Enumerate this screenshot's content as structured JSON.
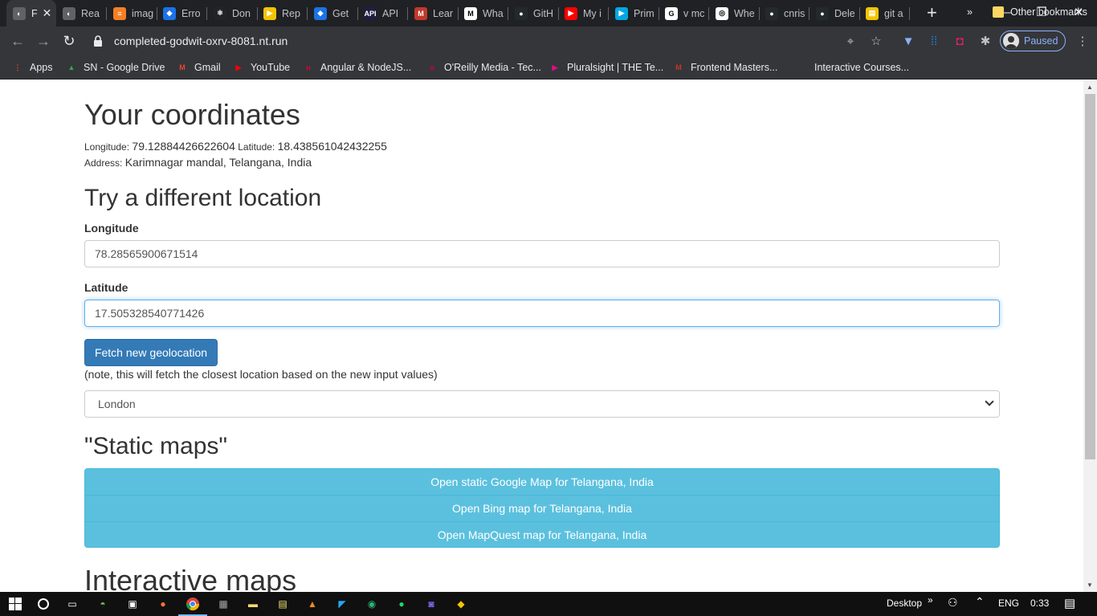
{
  "browser": {
    "tabs": [
      {
        "label": "F",
        "active": true,
        "color": "#5f6368",
        "glyph": "◐"
      },
      {
        "label": "Rea",
        "color": "#5f6368",
        "glyph": "◐"
      },
      {
        "label": "imag",
        "color": "#f48024",
        "glyph": "≡"
      },
      {
        "label": "Erro",
        "color": "#1a73e8",
        "glyph": "◆"
      },
      {
        "label": "Don",
        "color": "#20232a",
        "glyph": "⚛"
      },
      {
        "label": "Rep",
        "color": "#f5c400",
        "glyph": "▶"
      },
      {
        "label": "Get",
        "color": "#1a73e8",
        "glyph": "◆"
      },
      {
        "label": "API",
        "color": "#1e1e3f",
        "glyph": "API"
      },
      {
        "label": "Lear",
        "color": "#c0392b",
        "glyph": "M"
      },
      {
        "label": "Wha",
        "color": "#ffffff",
        "glyph": "M"
      },
      {
        "label": "GitH",
        "color": "#24292e",
        "glyph": "●"
      },
      {
        "label": "My i",
        "color": "#ff0000",
        "glyph": "▶"
      },
      {
        "label": "Prim",
        "color": "#00a8e1",
        "glyph": "▶"
      },
      {
        "label": "v mc",
        "color": "#ffffff",
        "glyph": "G"
      },
      {
        "label": "Whe",
        "color": "#ffffff",
        "glyph": "◎"
      },
      {
        "label": "cnris",
        "color": "#24292e",
        "glyph": "●"
      },
      {
        "label": "Dele",
        "color": "#24292e",
        "glyph": "●"
      },
      {
        "label": "git a",
        "color": "#f5c400",
        "glyph": "▤"
      }
    ],
    "url": "completed-godwit-oxrv-8081.nt.run",
    "profile_label": "Paused",
    "bookmarks": [
      {
        "label": "Apps",
        "icon": "apps-grid-icon",
        "color": "#ea4335",
        "glyph": "⋮"
      },
      {
        "label": "SN - Google Drive",
        "icon": "google-drive-icon",
        "color": "#34a853",
        "glyph": "▲"
      },
      {
        "label": "Gmail",
        "icon": "gmail-icon",
        "color": "#ea4335",
        "glyph": "M"
      },
      {
        "label": "YouTube",
        "icon": "youtube-icon",
        "color": "#ff0000",
        "glyph": "▶"
      },
      {
        "label": "Angular & NodeJS...",
        "icon": "angular-icon",
        "color": "#dd0031",
        "glyph": "u"
      },
      {
        "label": "O'Reilly Media - Tec...",
        "icon": "oreilly-icon",
        "color": "#d3002d",
        "glyph": "o"
      },
      {
        "label": "Pluralsight | THE Te...",
        "icon": "pluralsight-icon",
        "color": "#e80a89",
        "glyph": "▶"
      },
      {
        "label": "Frontend Masters...",
        "icon": "frontend-masters-icon",
        "color": "#c0392b",
        "glyph": "M"
      },
      {
        "label": "Interactive Courses...",
        "icon": "terminal-icon",
        "color": "#35363a",
        "glyph": ">_"
      }
    ],
    "other_bookmarks": "Other bookmarks"
  },
  "page": {
    "title": "Your coordinates",
    "longitude_label": "Longitude:",
    "longitude_value": "79.12884426622604",
    "latitude_label": "Latitude:",
    "latitude_value": "18.438561042432255",
    "address_label": "Address:",
    "address_value": "Karimnagar mandal, Telangana, India",
    "section_title": "Try a different location",
    "lon_field_label": "Longitude",
    "lon_field_value": "78.28565900671514",
    "lat_field_label": "Latitude",
    "lat_field_value": "17.505328540771426",
    "fetch_button": "Fetch new geolocation",
    "note": "(note, this will fetch the closest location based on the new input values)",
    "city_selected": "London",
    "static_title": "\"Static maps\"",
    "map_links": [
      "Open static Google Map for Telangana, India",
      "Open Bing map for Telangana, India",
      "Open MapQuest map for Telangana, India"
    ],
    "interactive_title": "Interactive maps"
  },
  "taskbar": {
    "desktop_label": "Desktop",
    "language": "ENG",
    "time": "0:33"
  }
}
